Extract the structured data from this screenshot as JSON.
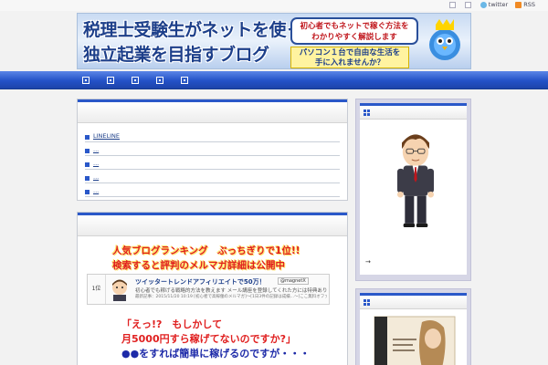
{
  "topbar": {
    "links": [
      {
        "icon": "edit-icon",
        "label": ""
      },
      {
        "icon": "home-icon",
        "label": ""
      },
      {
        "icon": "twitter-icon",
        "label": "twitter"
      },
      {
        "icon": "rss-icon",
        "label": "RSS"
      }
    ]
  },
  "header": {
    "title_line1": "税理士受験生がネットを使って",
    "title_line2": "独立起業を目指すブログ",
    "bubble_line1": "初心者でもネットで稼ぐ方法を",
    "bubble_line2": "わかりやすく解説します",
    "sub_line1": "パソコン１台で自由な生活を",
    "sub_line2": "手に入れませんか？"
  },
  "nav": {
    "items": [
      "",
      "",
      "",
      "",
      ""
    ]
  },
  "main": {
    "recent_list": [
      {
        "label": "LINELINE"
      },
      {
        "label": "..."
      },
      {
        "label": "..."
      },
      {
        "label": "..."
      },
      {
        "label": "..."
      }
    ],
    "ad": {
      "headline1": "人気ブログランキング　ぶっちぎりで1位!!",
      "headline2": "検索すると評判のメルマガ詳細は公開中",
      "card": {
        "rank": "1位",
        "title": "ツイッタートレンドアフィリエイトで50万！",
        "badge": "@magnetX",
        "desc1": "初心者でも稼げる戦略的方法を教えます メール講座を登録してくれた方には特典あり",
        "desc2": "最新記事：2015/11/20 10:19 [初心者で高稼働のメルマガ]～[1日3件の記録は成績...～]ここ無料オファー紹介パック"
      },
      "big1": "「えっ!?　もしかして",
      "big2": "月5000円すら稼げてないのですか?」",
      "big3": "●●をすれば簡単に稼げるのですが・・・"
    }
  },
  "sidebar": {
    "arrow": "→"
  },
  "colors": {
    "accent": "#2a58c9",
    "nav": "#2452c7",
    "headline_red": "#e02020"
  }
}
